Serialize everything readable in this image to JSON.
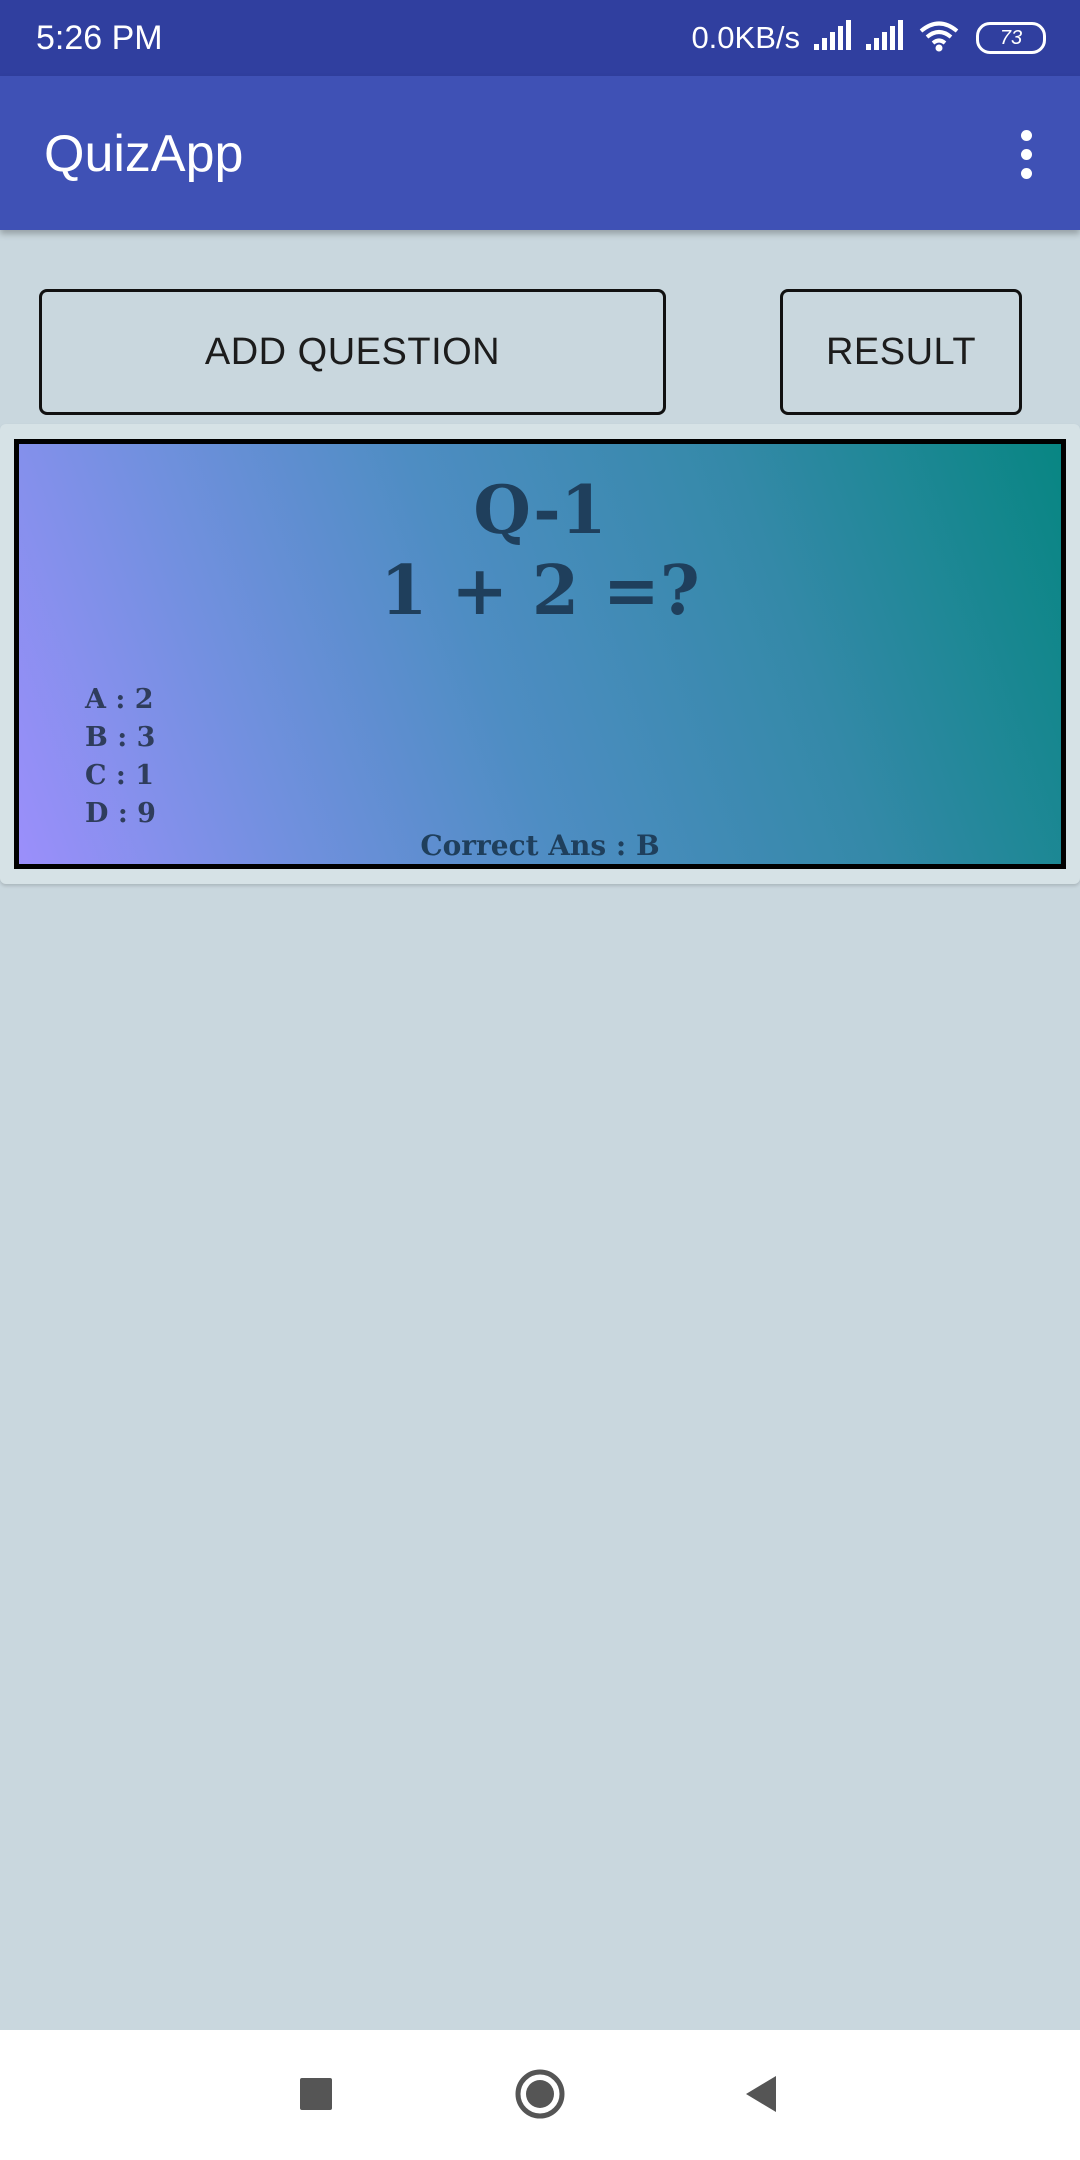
{
  "status_bar": {
    "time": "5:26 PM",
    "net_speed": "0.0KB/s",
    "battery": "73",
    "icons": [
      "signal-icon",
      "signal-icon",
      "wifi-icon",
      "battery-icon"
    ]
  },
  "app_bar": {
    "title": "QuizApp",
    "menu_icon": "more-vert-icon",
    "background": "#3f51b5"
  },
  "actions": {
    "add_question_label": "ADD QUESTION",
    "result_label": "RESULT"
  },
  "question": {
    "number": "Q-1",
    "text": "1 + 2 =?",
    "options": [
      "A : 2",
      "B : 3",
      "C : 1",
      "D : 9"
    ],
    "correct": "Correct Ans : B"
  },
  "nav_bar": {
    "icons": [
      "recent-apps-icon",
      "home-icon",
      "back-icon"
    ]
  },
  "colors": {
    "status_bar": "#303f9f",
    "app_bar": "#3f51b5",
    "page_background": "#c9d7de",
    "card_gradient_start": "#9b8ffb",
    "card_gradient_end": "#088683"
  }
}
